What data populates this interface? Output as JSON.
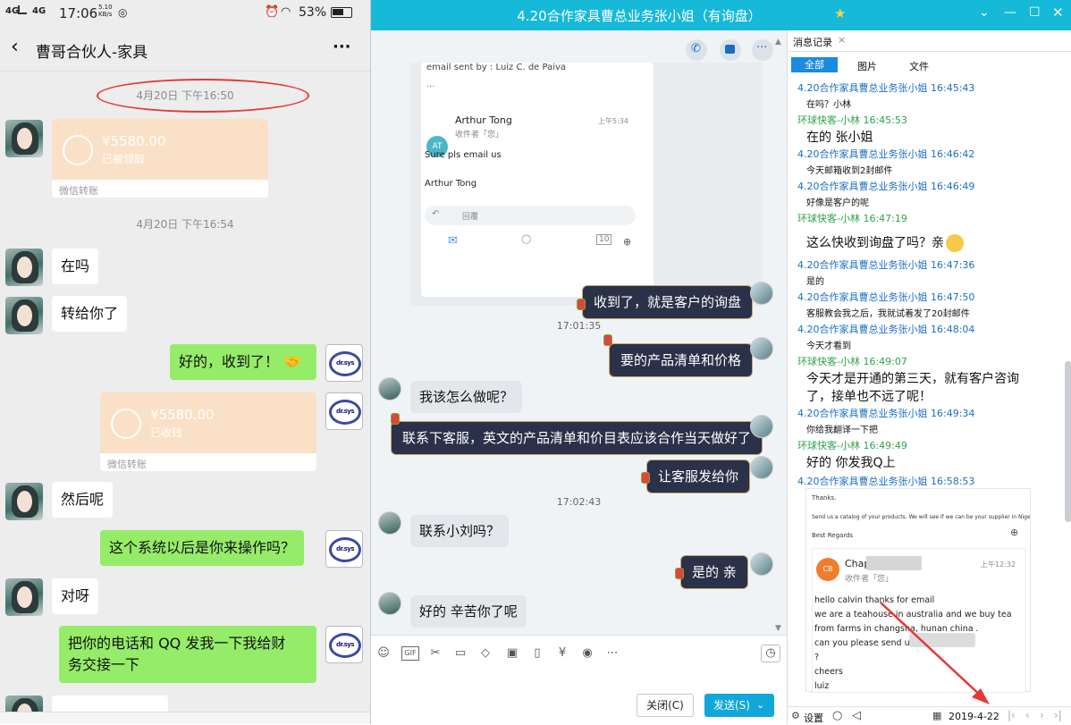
{
  "phone": {
    "status": {
      "carrier1": "4G",
      "carrier2": "4G",
      "time": "17:06",
      "speed": "5.10\nKB/s",
      "battery": "53%"
    },
    "chat_title": "曹哥合伙人-家具",
    "more": "···",
    "timestamps": [
      "4月20日 下午16:50",
      "4月20日 下午16:54"
    ],
    "transfer1": {
      "amount": "¥5580.00",
      "status": "已被领取",
      "label": "微信转账"
    },
    "transfer2": {
      "amount": "¥5580.00",
      "status": "已收钱",
      "label": "微信转账"
    },
    "msgs": {
      "m1": "在吗",
      "m2": "转给你了",
      "m3": "好的，收到了！",
      "m4": "然后呢",
      "m5": "这个系统以后是你来操作吗？",
      "m6": "对呀",
      "m7a": "把你的电话和 QQ 发我一下我给财",
      "m7b": "务交接一下"
    },
    "logo_text": "dr.sys"
  },
  "qq": {
    "title": "4.20合作家具曹总业务张小姐（有询盘）",
    "email_card": {
      "sent_by": "email sent by : Luiz C. de Paiva",
      "sender": "Arthur Tong",
      "time": "上午5:34",
      "recipient": "收件者「您」",
      "body1": "Sure pls email us",
      "body2": "Arthur Tong",
      "reply": "回覆",
      "attach": "10"
    },
    "chat": {
      "n1": "收到了，就是客户的询盘",
      "t1": "17:01:35",
      "n2": "要的产品清单和价格",
      "g1": "我该怎么做呢？",
      "n3": "联系下客服，英文的产品清单和价目表应该合作当天做好了",
      "n4": "让客服发给你",
      "t2": "17:02:43",
      "g2": "联系小刘吗？",
      "n5": "是的 亲",
      "g3": "好的 辛苦你了呢"
    },
    "buttons": {
      "close": "关闭(C)",
      "send": "发送(S)"
    },
    "history": {
      "tab": "消息记录",
      "filters": [
        "全部",
        "图片",
        "文件"
      ],
      "entries": [
        {
          "name": "4.20合作家具曹总业务张小姐 16:45:43",
          "type": "a"
        },
        {
          "msg": "在吗？小林",
          "size": "s"
        },
        {
          "name": "环球快客-小林 16:45:53",
          "type": "b"
        },
        {
          "msg": "在的 张小姐",
          "size": "b"
        },
        {
          "name": "4.20合作家具曹总业务张小姐 16:46:42",
          "type": "a"
        },
        {
          "msg": "今天邮箱收到2封邮件",
          "size": "s"
        },
        {
          "name": "4.20合作家具曹总业务张小姐 16:46:49",
          "type": "a"
        },
        {
          "msg": "好像是客户的呢",
          "size": "s"
        },
        {
          "name": "环球快客-小林 16:47:19",
          "type": "b"
        },
        {
          "msg": "这么快收到询盘了吗？亲",
          "size": "b"
        },
        {
          "name": "4.20合作家具曹总业务张小姐 16:47:36",
          "type": "a"
        },
        {
          "msg": "是的",
          "size": "s"
        },
        {
          "name": "4.20合作家具曹总业务张小姐 16:47:50",
          "type": "a"
        },
        {
          "msg": "客服教会我之后，我就试着发了20封邮件",
          "size": "s"
        },
        {
          "name": "4.20合作家具曹总业务张小姐 16:48:04",
          "type": "a"
        },
        {
          "msg": "今天才看到",
          "size": "s"
        },
        {
          "name": "环球快客-小林 16:49:07",
          "type": "b"
        },
        {
          "msg": "今天才是开通的第三天，就有客户咨询",
          "size": "b"
        },
        {
          "msg": "了，接单也不远了呢！",
          "size": "b"
        },
        {
          "name": "4.20合作家具曹总业务张小姐 16:49:34",
          "type": "a"
        },
        {
          "msg": "你给我翻译一下把",
          "size": "s"
        },
        {
          "name": "环球快客-小林 16:49:49",
          "type": "b"
        },
        {
          "msg": "好的 你发我Q上",
          "size": "b"
        },
        {
          "name": "4.20合作家具曹总业务张小姐 16:58:53",
          "type": "a"
        }
      ],
      "email": {
        "thanks": "Thanks.",
        "line": "Send us a catalog of your products. We will see if we can be your supplier in Nigeria.",
        "regards": "Best Regards",
        "sender": "Chap        king",
        "time": "上午12:32",
        "recipient": "收件者「您」",
        "body": [
          "hello calvin thanks for email",
          "we are a teahouse in australia and we buy tea",
          "from farms in changsha, hunan china .",
          "can you please send u               prices",
          "?",
          "cheers",
          "luiz"
        ]
      },
      "bottom": {
        "settings": "设置",
        "date": "2019-4-22"
      }
    }
  },
  "colors": {
    "wechat_green": "#95ec69",
    "qq_blue": "#16b9d8",
    "accent_red": "#e53935"
  }
}
